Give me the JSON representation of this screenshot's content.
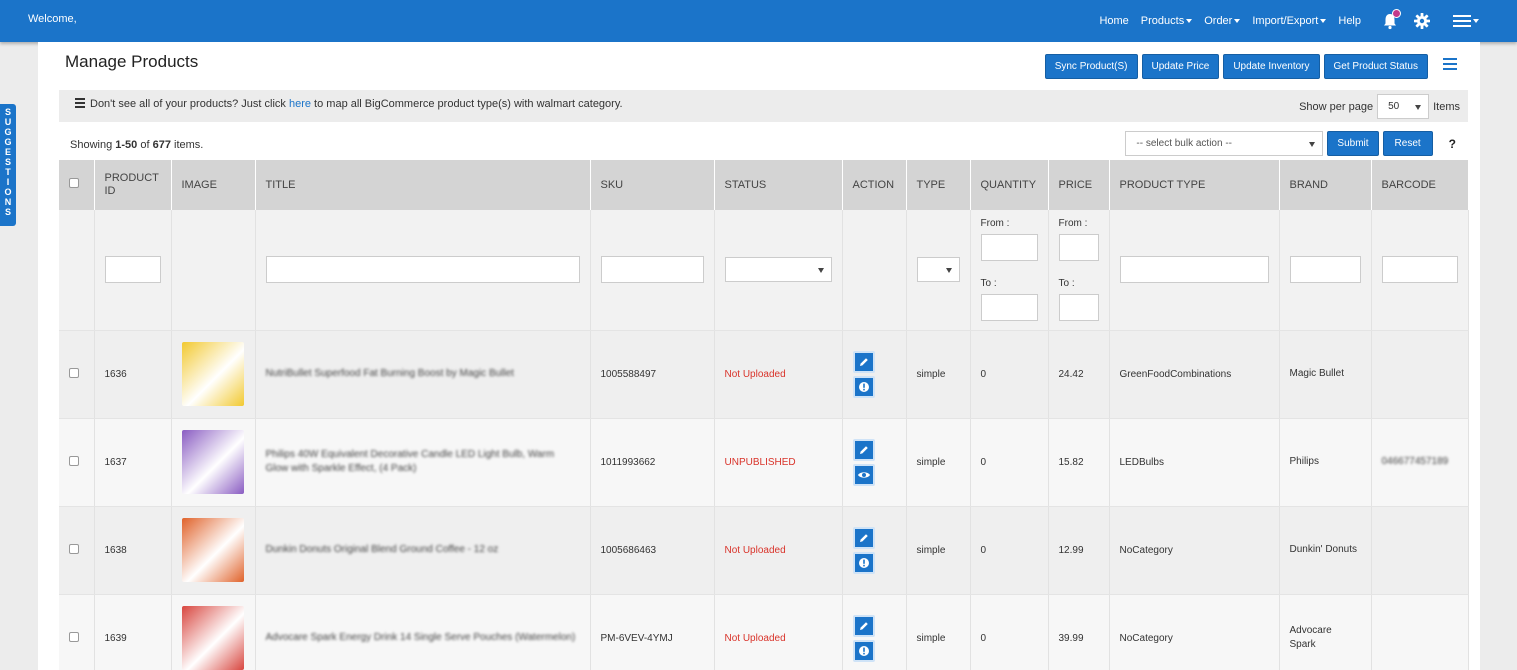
{
  "navbar": {
    "welcome": "Welcome,",
    "items": [
      {
        "label": "Home",
        "dropdown": false
      },
      {
        "label": "Products",
        "dropdown": true
      },
      {
        "label": "Order",
        "dropdown": true
      },
      {
        "label": "Import/Export",
        "dropdown": true
      },
      {
        "label": "Help",
        "dropdown": false
      }
    ]
  },
  "suggestions_letters": [
    "S",
    "U",
    "G",
    "G",
    "E",
    "S",
    "T",
    "I",
    "O",
    "N",
    "S"
  ],
  "page": {
    "title": "Manage Products",
    "buttons": [
      "Sync Product(S)",
      "Update Price",
      "Update Inventory",
      "Get Product Status"
    ]
  },
  "info": {
    "text_before": "Don't see all of your products? Just click ",
    "link": "here",
    "text_after": " to map all BigCommerce product type(s) with walmart category."
  },
  "pagination": {
    "show_per_page_label": "Show per page",
    "per_page_value": "50",
    "items_label": "Items",
    "showing_prefix": "Showing ",
    "showing_range": "1-50",
    "showing_of": " of ",
    "showing_total": "677",
    "showing_suffix": " items."
  },
  "bulk": {
    "placeholder": "-- select bulk action --",
    "submit": "Submit",
    "reset": "Reset",
    "help": "?"
  },
  "table": {
    "headers": [
      "PRODUCT ID",
      "IMAGE",
      "TITLE",
      "SKU",
      "STATUS",
      "ACTION",
      "TYPE",
      "QUANTITY",
      "PRICE",
      "PRODUCT TYPE",
      "BRAND",
      "BARCODE"
    ],
    "filter": {
      "from_label": "From :",
      "to_label": "To :"
    },
    "rows": [
      {
        "id": "1636",
        "title": "NutriBullet Superfood Fat Burning Boost by Magic Bullet",
        "sku": "1005588497",
        "status": "Not Uploaded",
        "action2": "info-icon",
        "type": "simple",
        "quantity": "0",
        "price": "24.42",
        "product_type": "GreenFoodCombinations",
        "brand": "Magic Bullet",
        "barcode": "",
        "thumb_color": "#f2c930"
      },
      {
        "id": "1637",
        "title": "Philips 40W Equivalent Decorative Candle LED Light Bulb, Warm Glow with Sparkle Effect, (4 Pack)",
        "sku": "1011993662",
        "status": "UNPUBLISHED",
        "action2": "eye-icon",
        "type": "simple",
        "quantity": "0",
        "price": "15.82",
        "product_type": "LEDBulbs",
        "brand": "Philips",
        "barcode": "046677457189",
        "thumb_color": "#8a5cc2"
      },
      {
        "id": "1638",
        "title": "Dunkin Donuts Original Blend Ground Coffee - 12 oz",
        "sku": "1005686463",
        "status": "Not Uploaded",
        "action2": "info-icon",
        "type": "simple",
        "quantity": "0",
        "price": "12.99",
        "product_type": "NoCategory",
        "brand": "Dunkin' Donuts",
        "barcode": "",
        "thumb_color": "#e0622a"
      },
      {
        "id": "1639",
        "title": "Advocare Spark Energy Drink 14 Single Serve Pouches (Watermelon)",
        "sku": "PM-6VEV-4YMJ",
        "status": "Not Uploaded",
        "action2": "info-icon",
        "type": "simple",
        "quantity": "0",
        "price": "39.99",
        "product_type": "NoCategory",
        "brand": "Advocare Spark",
        "barcode": "",
        "thumb_color": "#d8463f"
      }
    ]
  }
}
